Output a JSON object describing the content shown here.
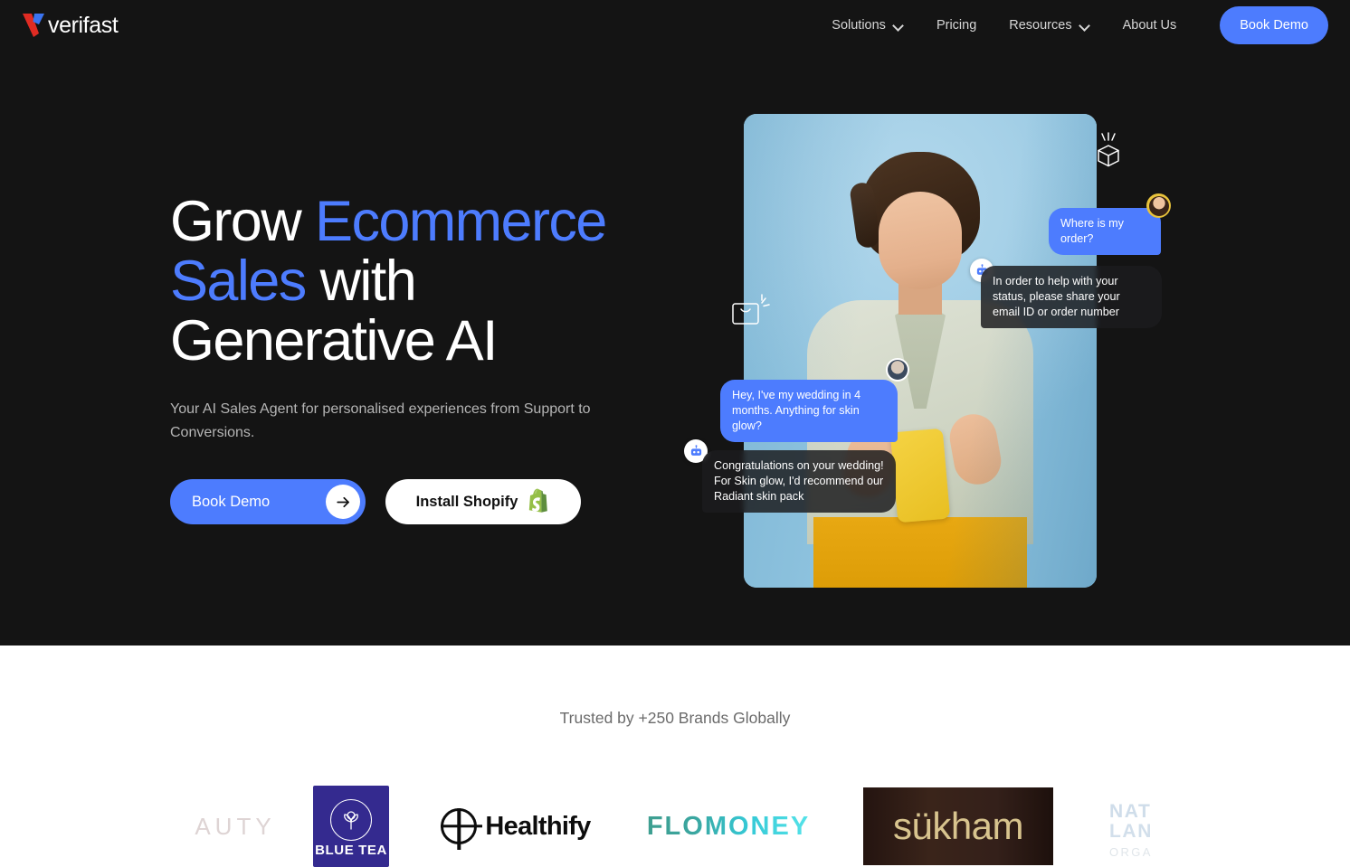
{
  "brand": {
    "name": "verifast",
    "logo_icon": "verifast-v-logo",
    "accent_blue": "#4d7cfe",
    "logo_red": "#e02b23",
    "logo_blue": "#3b74f1"
  },
  "nav": {
    "items": [
      {
        "label": "Solutions",
        "has_dropdown": true
      },
      {
        "label": "Pricing",
        "has_dropdown": false
      },
      {
        "label": "Resources",
        "has_dropdown": true
      },
      {
        "label": "About Us",
        "has_dropdown": false
      }
    ],
    "cta_label": "Book Demo"
  },
  "hero": {
    "title_line1_a": "Grow ",
    "title_line1_b": "Ecommerce",
    "title_line2_a": "Sales",
    "title_line2_b": " with",
    "title_line3": "Generative AI",
    "subtitle": "Your AI Sales Agent for personalised experiences from Support to Conversions.",
    "primary_button": "Book Demo",
    "primary_button_icon": "arrow-right-icon",
    "secondary_button": "Install Shopify",
    "secondary_button_icon": "shopify-bag-icon",
    "deco_icons": [
      "package-box-icon",
      "shopping-bag-icon"
    ]
  },
  "chat": {
    "messages": [
      {
        "sender": "user",
        "text": "Where is my order?",
        "avatar": "user-avatar-yellow"
      },
      {
        "sender": "bot",
        "text": "In order to help with your status, please share your email ID or order number",
        "avatar": "bot-avatar-icon"
      },
      {
        "sender": "user",
        "text": "Hey, I've my wedding in 4 months. Anything for skin glow?",
        "avatar": "user-avatar-photo"
      },
      {
        "sender": "bot",
        "text": "Congratulations on your wedding! For Skin glow, I'd recommend our Radiant skin pack",
        "avatar": "bot-avatar-icon"
      }
    ]
  },
  "trusted": {
    "heading": "Trusted by +250 Brands Globally",
    "logos": [
      {
        "name": "AUTY",
        "text": "AUTY"
      },
      {
        "name": "Blue Tea",
        "text": "BLUE TEA"
      },
      {
        "name": "Healthify",
        "text": "Healthify"
      },
      {
        "name": "FLOMONEY",
        "text": "FLOMONEY"
      },
      {
        "name": "sukham",
        "text": "sükham"
      },
      {
        "name": "Nat Lan Organics",
        "line1": "NAT",
        "line2": "LAN",
        "line3": "ORGA"
      }
    ]
  }
}
